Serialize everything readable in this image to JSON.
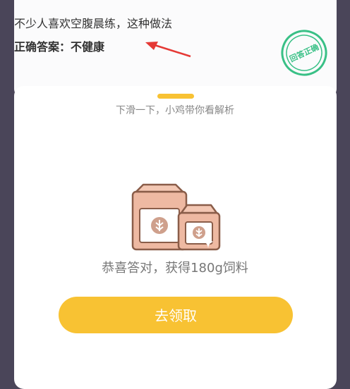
{
  "question": {
    "text": "不少人喜欢空腹晨练，这种做法",
    "answer": "正确答案：不健康"
  },
  "stamp": {
    "text": "回答正确"
  },
  "panel": {
    "hint": "下滑一下，小鸡带你看解析",
    "reward_text": "恭喜答对，获得180g饲料",
    "claim_label": "去领取"
  },
  "colors": {
    "accent": "#f8c233",
    "stamp": "#39c086",
    "arrow": "#e53935",
    "bag": "#eeb9a2"
  }
}
